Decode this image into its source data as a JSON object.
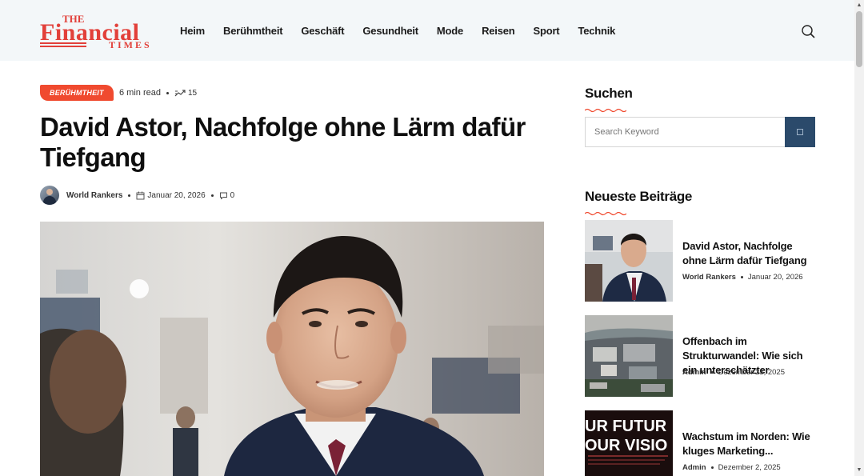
{
  "header": {
    "logo_line1": "THE",
    "logo_line2": "Financial",
    "logo_line3": "TIMES",
    "nav": [
      "Heim",
      "Berühmtheit",
      "Geschäft",
      "Gesundheit",
      "Mode",
      "Reisen",
      "Sport",
      "Technik"
    ]
  },
  "article": {
    "category": "BERÜHMTHEIT",
    "read_time": "6 min read",
    "views": "15",
    "title": "David Astor, Nachfolge ohne Lärm dafür Tiefgang",
    "author": "World Rankers",
    "date": "Januar 20, 2026",
    "comments": "0"
  },
  "sidebar": {
    "search_heading": "Suchen",
    "search_placeholder": "Search Keyword",
    "recent_heading": "Neueste Beiträge",
    "posts": [
      {
        "title": "David Astor, Nachfolge ohne Lärm dafür Tiefgang",
        "author": "World Rankers",
        "date": "Januar 20, 2026"
      },
      {
        "title": "Offenbach im Strukturwandel: Wie sich ein unterschätzter",
        "author": "Admin",
        "date": "Dezember 23, 2025"
      },
      {
        "title": "Wachstum im Norden: Wie kluges Marketing...",
        "author": "Admin",
        "date": "Dezember 2, 2025",
        "thumb_text_1": "UR FUTUR",
        "thumb_text_2": "OUR VISIO"
      }
    ]
  },
  "colors": {
    "accent": "#f04a2f",
    "logo_red": "#e2403a",
    "search_button": "#2b4a6b",
    "header_bg": "#f3f7f9"
  }
}
